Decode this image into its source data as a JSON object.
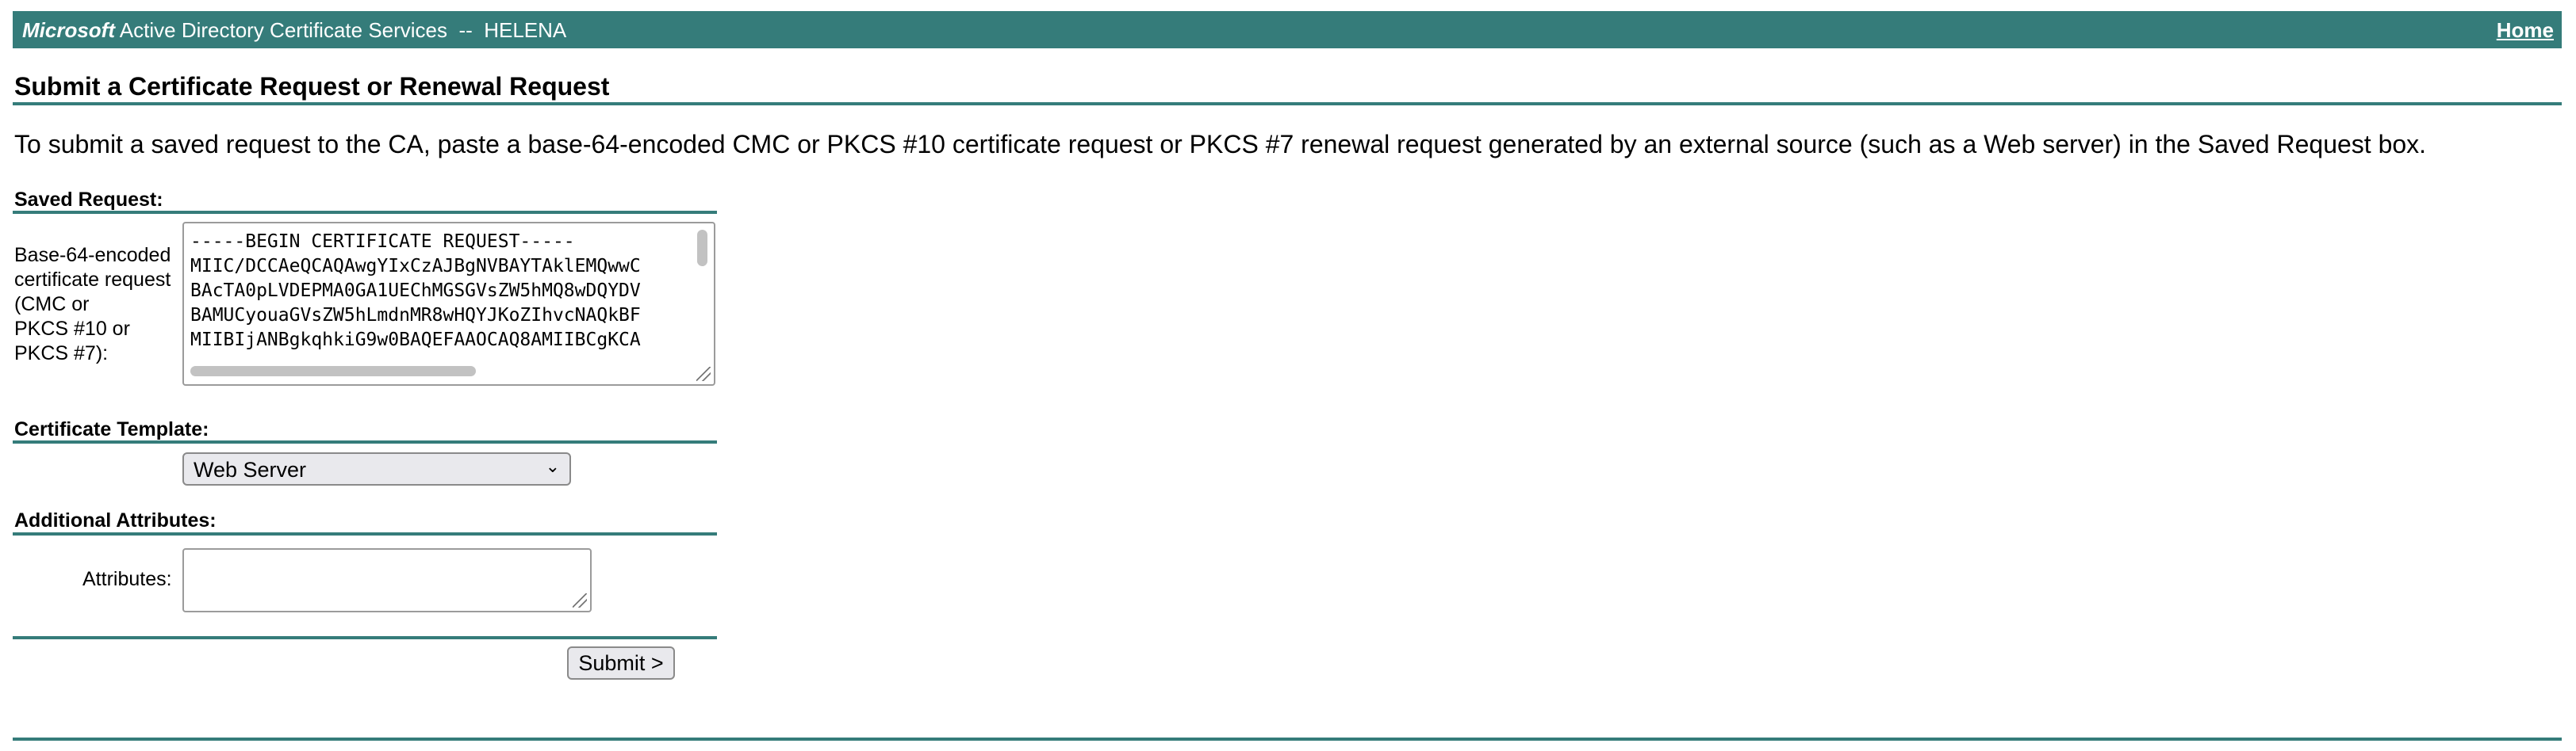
{
  "header": {
    "brand_bold": "Microsoft",
    "brand_rest": " Active Directory Certificate Services  --  HELENA",
    "home_link": "Home"
  },
  "page": {
    "title": "Submit a Certificate Request or Renewal Request",
    "intro": "To submit a saved request to the CA, paste a base-64-encoded CMC or PKCS #10 certificate request or PKCS #7 renewal request generated by an external source (such as a Web server) in the Saved Request box."
  },
  "saved_request": {
    "section_label": "Saved Request:",
    "field_label_lines": [
      "Base-64-encoded",
      "certificate request",
      "(CMC or",
      "PKCS #10 or",
      "PKCS #7):"
    ],
    "lines": [
      "-----BEGIN CERTIFICATE REQUEST-----",
      "MIIC/DCCAeQCAQAwgYIxCzAJBgNVBAYTAklEMQwwC",
      "BAcTA0pLVDEPMA0GA1UEChMGSGVsZW5hMQ8wDQYDV",
      "BAMUCyouaGVsZW5hLmdnMR8wHQYJKoZIhvcNAQkBF",
      "MIIBIjANBgkqhkiG9w0BAQEFAAOCAQ8AMIIBCgKCA"
    ]
  },
  "certificate_template": {
    "section_label": "Certificate Template:",
    "selected": "Web Server"
  },
  "additional_attributes": {
    "section_label": "Additional Attributes:",
    "field_label": "Attributes:",
    "value": ""
  },
  "actions": {
    "submit_label": "Submit >"
  },
  "colors": {
    "accent": "#357c7a"
  }
}
